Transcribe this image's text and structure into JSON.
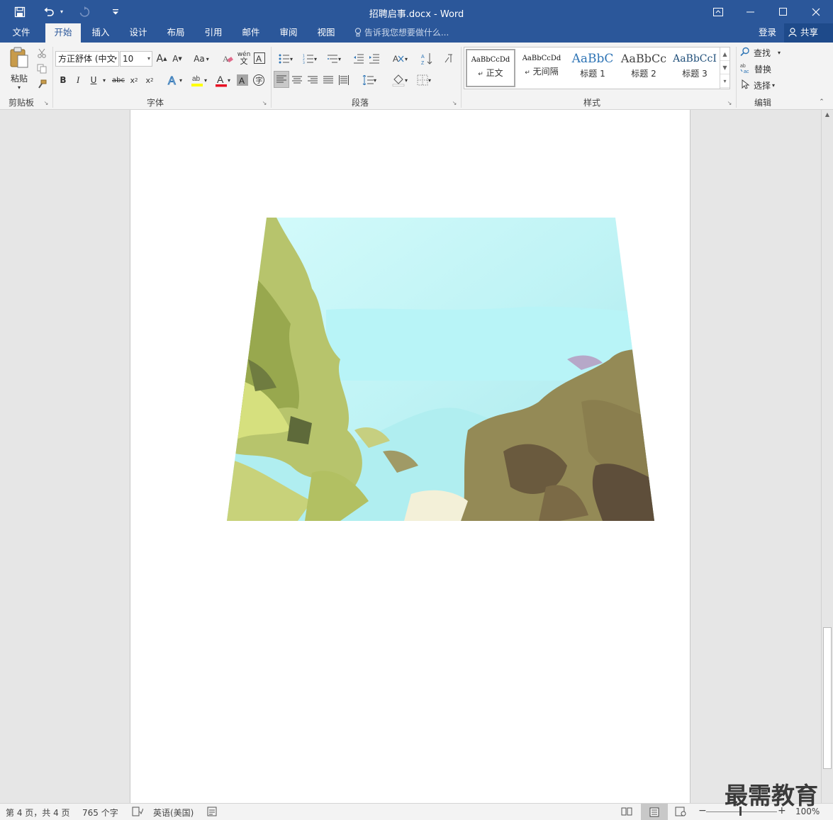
{
  "window": {
    "title": "招聘启事.docx - Word"
  },
  "qat": {
    "save_icon": "save-icon",
    "undo_icon": "undo-icon",
    "redo_icon": "redo-icon",
    "customize_icon": "customize-qat-icon"
  },
  "tabs": [
    {
      "label": "文件"
    },
    {
      "label": "开始"
    },
    {
      "label": "插入"
    },
    {
      "label": "设计"
    },
    {
      "label": "布局"
    },
    {
      "label": "引用"
    },
    {
      "label": "邮件"
    },
    {
      "label": "审阅"
    },
    {
      "label": "视图"
    }
  ],
  "active_tab": "开始",
  "tell_me": "告诉我您想要做什么...",
  "account": {
    "login": "登录",
    "share": "共享"
  },
  "ribbon": {
    "clipboard": {
      "paste": "粘贴",
      "label": "剪贴板"
    },
    "font": {
      "label": "字体",
      "font_name": "方正舒体 (中文",
      "font_size": "10",
      "change_case": "Aa",
      "wen": "wén",
      "wen_sub": "文"
    },
    "paragraph": {
      "label": "段落"
    },
    "styles": {
      "label": "样式",
      "items": [
        {
          "preview": "AaBbCcDd",
          "name": "正文",
          "mark": "↵"
        },
        {
          "preview": "AaBbCcDd",
          "name": "无间隔",
          "mark": "↵"
        },
        {
          "preview": "AaBbC",
          "name": "标题 1"
        },
        {
          "preview": "AaBbCc",
          "name": "标题 2"
        },
        {
          "preview": "AaBbCcI",
          "name": "标题 3"
        }
      ]
    },
    "editing": {
      "label": "编辑",
      "find": "查找",
      "replace": "替换",
      "select": "选择"
    }
  },
  "status": {
    "page": "第 4 页，共 4 页",
    "words": "765 个字",
    "language": "英语(美国)",
    "zoom": "100%"
  },
  "watermark": "最需教育",
  "colors": {
    "brand": "#2b579a",
    "highlight": "#ffff00",
    "font_color": "#e81123"
  }
}
